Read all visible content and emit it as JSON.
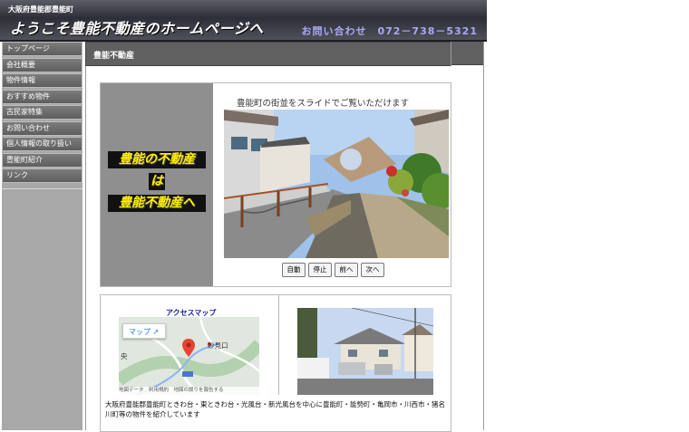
{
  "header": {
    "prefecture": "大阪府豊能郡豊能町",
    "title": "ようこそ豊能不動産のホームページへ",
    "contact": "お問い合わせ　072－738－5321"
  },
  "sidebar": {
    "items": [
      {
        "label": "トップページ"
      },
      {
        "label": "会社概要"
      },
      {
        "label": "物件情報"
      },
      {
        "label": "おすすめ物件"
      },
      {
        "label": "古民家特集"
      },
      {
        "label": "お問い合わせ"
      },
      {
        "label": "個人情報の取り扱い"
      },
      {
        "label": "豊能町紹介"
      },
      {
        "label": "リンク"
      }
    ]
  },
  "main": {
    "section_title": "豊能不動産",
    "promo": {
      "line1": "豊能の不動産",
      "line2": "は",
      "line3": "豊能不動産へ"
    },
    "slideshow": {
      "caption": "豊能町の街並をスライドでご覧いただけます",
      "buttons": {
        "auto": "自動",
        "stop": "停止",
        "prev": "前へ",
        "next": "次へ"
      }
    },
    "access": {
      "title": "アクセスマップ",
      "map_button": "マップ",
      "place_label": "妙見口",
      "left_label": "央",
      "footer": "地図データ　利用規約　地図の誤りを報告する"
    },
    "description": "大阪府豊能郡豊能町ときわ台・東ときわ台・光風台・新光風台を中心に豊能町・能勢町・亀岡市・川西市・猪名川町等の物件を紹介しています"
  },
  "colors": {
    "accent_yellow": "#ffee00",
    "contact_lavender": "#a9aaf2",
    "header_gray": "#606060",
    "sidebar_gray": "#a8a8a8"
  }
}
